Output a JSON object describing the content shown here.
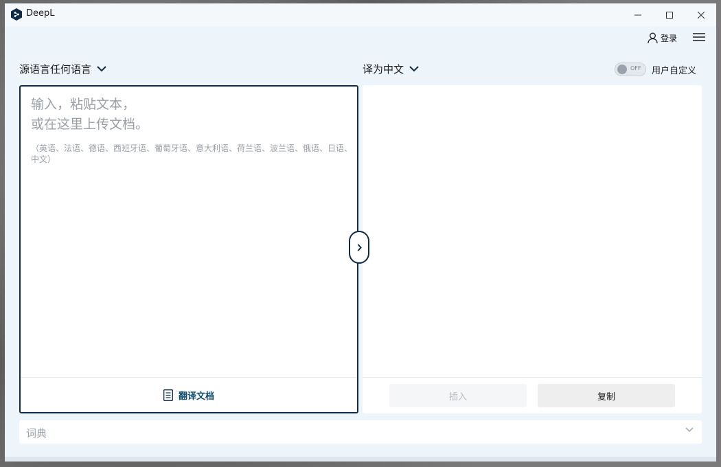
{
  "window": {
    "title": "DeepL"
  },
  "header": {
    "login_label": "登录"
  },
  "source": {
    "language_label": "源语言任何语言",
    "placeholder": "输入，粘贴文本，\n或在这里上传文档。",
    "hint": "（英语、法语、德语、西班牙语、葡萄牙语、意大利语、荷兰语、波兰语、俄语、日语、中文）",
    "translate_doc_label": "翻译文档"
  },
  "target": {
    "language_label": "译为中文",
    "insert_label": "插入",
    "copy_label": "复制"
  },
  "customize": {
    "toggle_state": "OFF",
    "label": "用户自定义"
  },
  "dictionary": {
    "label": "词典"
  },
  "colors": {
    "accent": "#0f2b46",
    "link": "#0f4c6e",
    "background": "#edf4fa"
  }
}
